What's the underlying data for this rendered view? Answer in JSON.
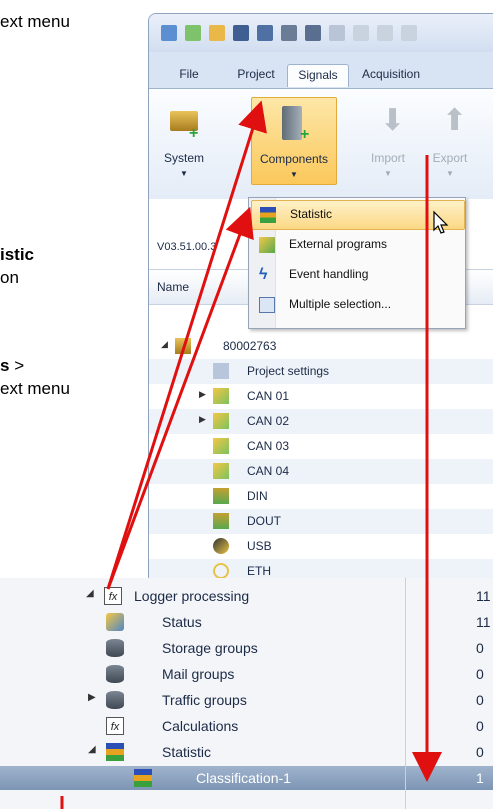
{
  "doc_text": {
    "line1": "ext menu",
    "line2": "istic",
    "line3": "on",
    "line4_bold": "s",
    "line4_rest": " >",
    "line5": "ext menu"
  },
  "tabs": [
    "File",
    "Project",
    "Signals",
    "Acquisition"
  ],
  "ribbon": {
    "system": "System",
    "components": "Components",
    "import": "Import",
    "export": "Export"
  },
  "version": "V03.51.00.3",
  "column_header": "Name",
  "menu": {
    "items": [
      "Statistic",
      "External programs",
      "Event handling",
      "Multiple selection..."
    ]
  },
  "tree": {
    "root": "80002763",
    "items": [
      "Project settings",
      "CAN 01",
      "CAN 02",
      "CAN 03",
      "CAN 04",
      "DIN",
      "DOUT",
      "USB",
      "ETH"
    ]
  },
  "detail": {
    "rows": [
      {
        "label": "Logger processing",
        "value": "11"
      },
      {
        "label": "Status",
        "value": "11"
      },
      {
        "label": "Storage groups",
        "value": "0"
      },
      {
        "label": "Mail groups",
        "value": "0"
      },
      {
        "label": "Traffic groups",
        "value": "0"
      },
      {
        "label": "Calculations",
        "value": "0"
      },
      {
        "label": "Statistic",
        "value": "0"
      },
      {
        "label": "Classification-1",
        "value": "1"
      }
    ]
  },
  "colors": {
    "arrow": "#e01010",
    "menu_highlight": "#fbd884",
    "ribbon_selected": "#fbc85b"
  }
}
